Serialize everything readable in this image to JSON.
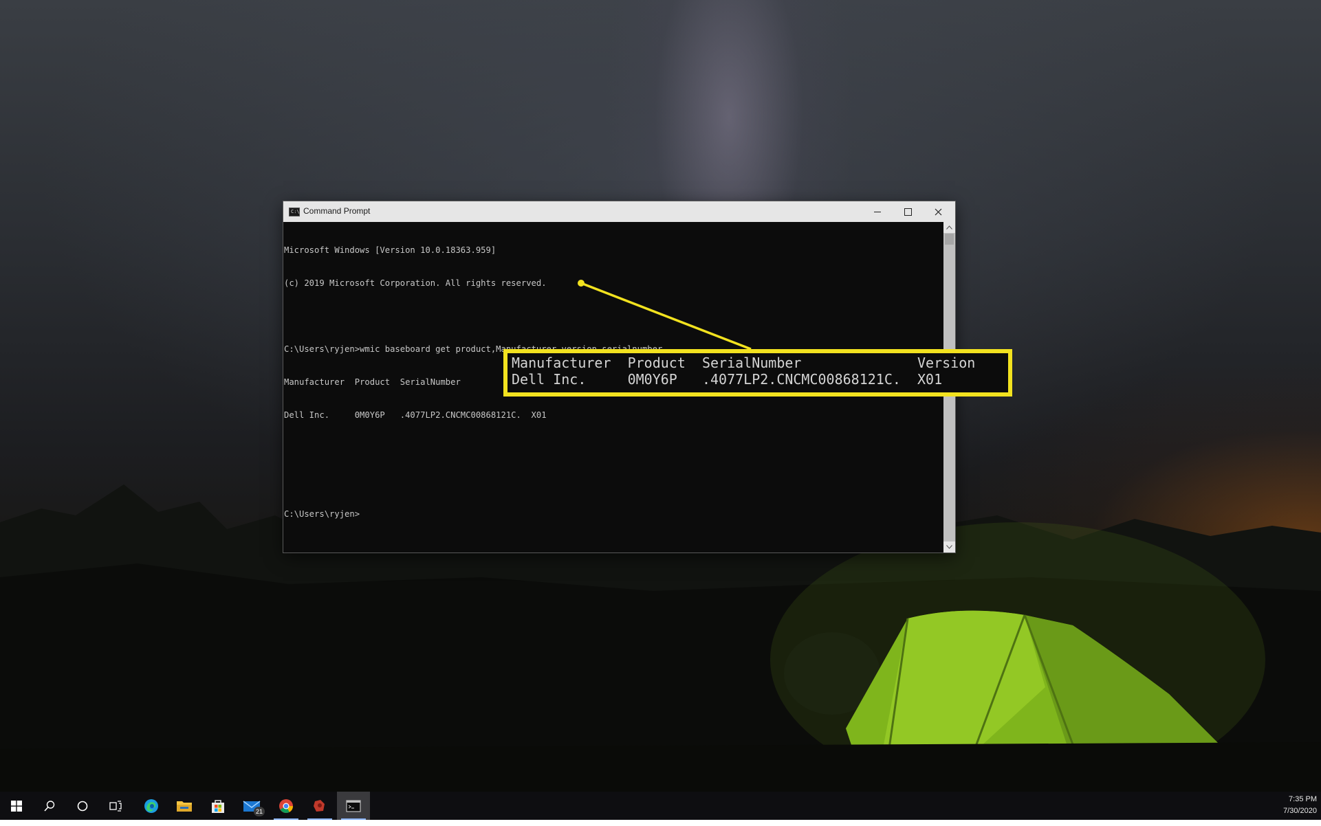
{
  "window": {
    "title": "Command Prompt",
    "app_icon_glyph": "C:\\",
    "minimize_icon": "minimize-icon",
    "maximize_icon": "maximize-icon",
    "close_icon": "close-icon"
  },
  "console": {
    "lines": [
      "Microsoft Windows [Version 10.0.18363.959]",
      "(c) 2019 Microsoft Corporation. All rights reserved.",
      "",
      "C:\\Users\\ryjen>wmic baseboard get product,Manufacturer,version,serialnumber",
      "Manufacturer  Product  SerialNumber              Version",
      "Dell Inc.     0M0Y6P   .4077LP2.CNCMC00868121C.  X01",
      "",
      "",
      "C:\\Users\\ryjen>"
    ]
  },
  "callout": {
    "header": "Manufacturer  Product  SerialNumber              Version",
    "row": "Dell Inc.     0M0Y6P   .4077LP2.CNCMC00868121C.  X01",
    "color": "#f2e21f"
  },
  "taskbar": {
    "items": [
      {
        "name": "start-button",
        "icon": "windows-logo-icon"
      },
      {
        "name": "search-button",
        "icon": "search-icon"
      },
      {
        "name": "cortana-button",
        "icon": "circle-icon"
      },
      {
        "name": "task-view-button",
        "icon": "task-view-icon"
      },
      {
        "name": "edge-button",
        "icon": "edge-icon"
      },
      {
        "name": "file-explorer-button",
        "icon": "folder-icon"
      },
      {
        "name": "store-button",
        "icon": "store-bag-icon"
      },
      {
        "name": "mail-button",
        "icon": "mail-icon"
      },
      {
        "name": "chrome-button",
        "icon": "chrome-icon"
      },
      {
        "name": "app-button",
        "icon": "red-app-icon"
      },
      {
        "name": "command-prompt-button",
        "icon": "terminal-icon"
      }
    ],
    "mail_badge": "21",
    "clock_time": "7:35 PM",
    "clock_date": "7/30/2020"
  }
}
